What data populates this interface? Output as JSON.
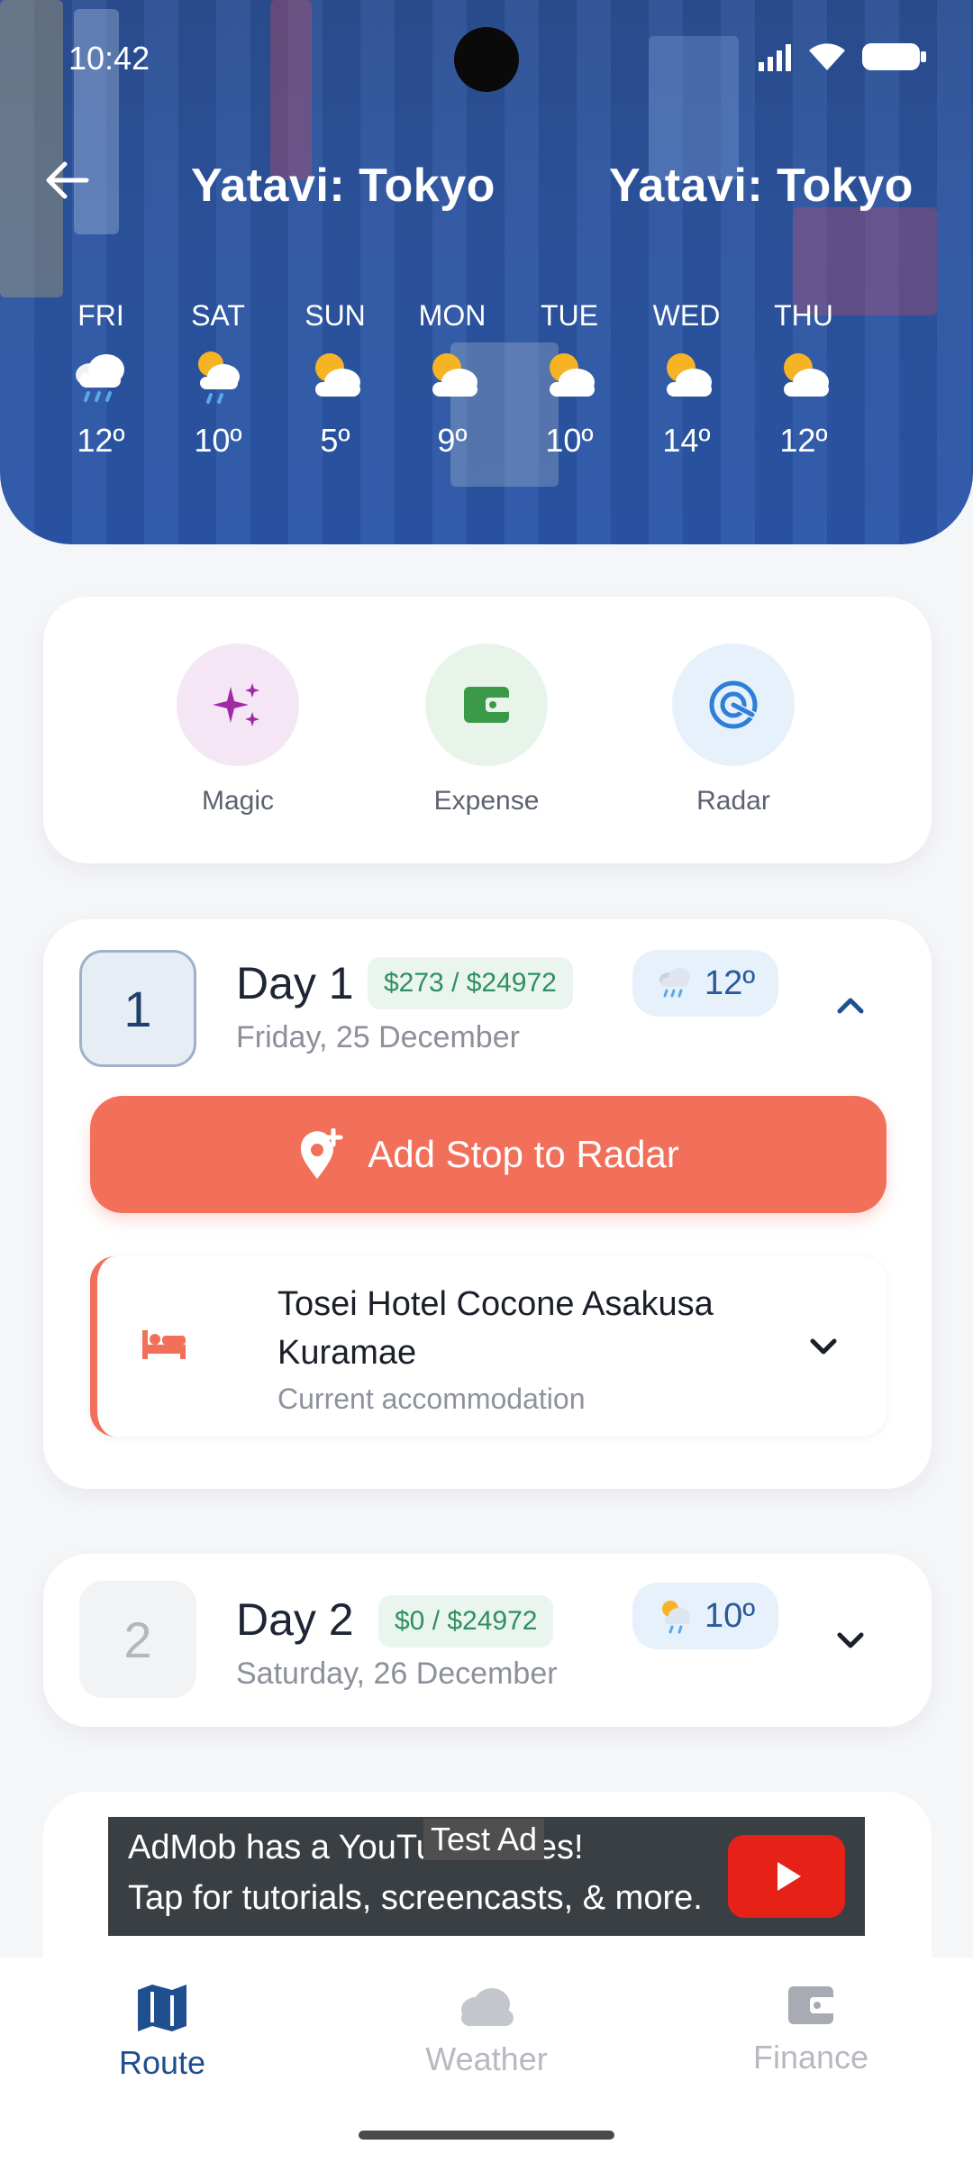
{
  "status_bar": {
    "time": "10:42"
  },
  "header": {
    "title": "Yatavi: Tokyo",
    "title_repeat": "Yatavi: Tokyo",
    "forecast": [
      {
        "day": "FRI",
        "icon": "rain-cloud-icon",
        "temp": "12º"
      },
      {
        "day": "SAT",
        "icon": "sun-rain-cloud-icon",
        "temp": "10º"
      },
      {
        "day": "SUN",
        "icon": "sun-cloud-icon",
        "temp": "5º"
      },
      {
        "day": "MON",
        "icon": "sun-cloud-icon",
        "temp": "9º"
      },
      {
        "day": "TUE",
        "icon": "sun-cloud-icon",
        "temp": "10º"
      },
      {
        "day": "WED",
        "icon": "sun-cloud-icon",
        "temp": "14º"
      },
      {
        "day": "THU",
        "icon": "sun-cloud-icon",
        "temp": "12º"
      }
    ]
  },
  "actions": [
    {
      "label": "Magic",
      "icon": "sparkles-icon",
      "bg": "#f5e6f6",
      "color": "#a02aa6"
    },
    {
      "label": "Expense",
      "icon": "wallet-icon",
      "bg": "#e8f4ea",
      "color": "#3a9a4a"
    },
    {
      "label": "Radar",
      "icon": "radar-icon",
      "bg": "#e6f1fb",
      "color": "#2f7fd8"
    }
  ],
  "days": [
    {
      "number": "1",
      "title": "Day 1",
      "budget": "$273 / $24972",
      "temp": "12º",
      "weather_icon": "rain-cloud-icon",
      "date": "Friday, 25 December",
      "expanded": true,
      "add_stop_label": "Add Stop to Radar",
      "accommodation": {
        "name": "Tosei Hotel Cocone Asakusa Kuramae",
        "subtitle": "Current accommodation"
      }
    },
    {
      "number": "2",
      "title": "Day 2",
      "budget": "$0 / $24972",
      "temp": "10º",
      "weather_icon": "sun-rain-cloud-icon",
      "date": "Saturday, 26 December",
      "expanded": false
    }
  ],
  "ad": {
    "line1": "AdMob has a YouTube series!",
    "line2": "Tap for tutorials, screencasts, & more.",
    "tag": "Test Ad"
  },
  "nav": [
    {
      "label": "Route",
      "icon": "map-icon",
      "active": true
    },
    {
      "label": "Weather",
      "icon": "cloud-icon",
      "active": false
    },
    {
      "label": "Finance",
      "icon": "wallet-icon",
      "active": false
    }
  ],
  "colors": {
    "accent": "#f2705a",
    "primary": "#1f4f8f",
    "budget_green": "#2f8f61"
  }
}
